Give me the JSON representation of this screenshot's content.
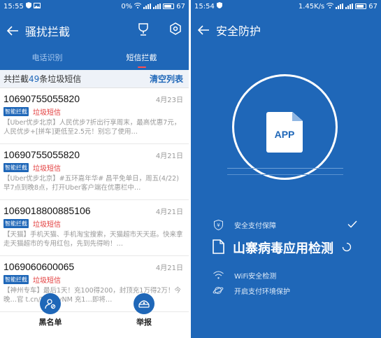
{
  "left": {
    "status": {
      "time": "15:55",
      "battery_pct": "0%",
      "battery": "67"
    },
    "header": {
      "title": "骚扰拦截"
    },
    "tabs": [
      {
        "label": "电话识别"
      },
      {
        "label": "短信拦截"
      }
    ],
    "summary": {
      "prefix": "共拦截",
      "count": "49",
      "suffix": "条垃圾短信",
      "clear": "清空列表"
    },
    "messages": [
      {
        "number": "10690755055820",
        "date": "4月23日",
        "tag": "智能拦截",
        "type": "垃圾短信",
        "text": "【Uber优步北京】人民优步7折出行享周末，最高优惠7元，人民优步+[拼车]更低至2.5元！别忘了使用…"
      },
      {
        "number": "10690755055820",
        "date": "4月21日",
        "tag": "智能拦截",
        "type": "垃圾短信",
        "text": "【Uber优步北京】#五环嘉年华# 昌平免单日，周五(4/22) 早7点到晚8点，打开Uber客户端在优惠栏中…"
      },
      {
        "number": "1069018800885106",
        "date": "4月21日",
        "tag": "智能拦截",
        "type": "垃圾短信",
        "text": "【天猫】手机天猫、手机淘宝搜索，天猫超市天天逛。快来拿走天猫超市的专用红包，先到先得哟！…"
      },
      {
        "number": "1069060600065",
        "date": "4月21日",
        "tag": "智能拦截",
        "type": "垃圾短信",
        "text": "【神州专车】最后1天！充100得200，封顶充1万得2万！今晚…官 t.cn/RqXqyNM 充1…即将…"
      }
    ],
    "bottom": {
      "blacklist": "黑名单",
      "report": "举报"
    }
  },
  "right": {
    "status": {
      "time": "15:54",
      "speed": "1.45K/s",
      "battery": "67"
    },
    "header": {
      "title": "安全防护"
    },
    "app_label": "APP",
    "checks": [
      {
        "label": "安全支付保障",
        "icon": "payment-shield-icon"
      },
      {
        "label": "山寨病毒应用检测",
        "icon": "document-icon"
      },
      {
        "label": "WiFi安全检测",
        "icon": "wifi-icon"
      },
      {
        "label": "开启支付环境保护",
        "icon": "planet-icon"
      }
    ]
  },
  "colors": {
    "primary": "#1f67b8",
    "spam": "#e23b3b",
    "indicator": "#ff4d4f"
  }
}
